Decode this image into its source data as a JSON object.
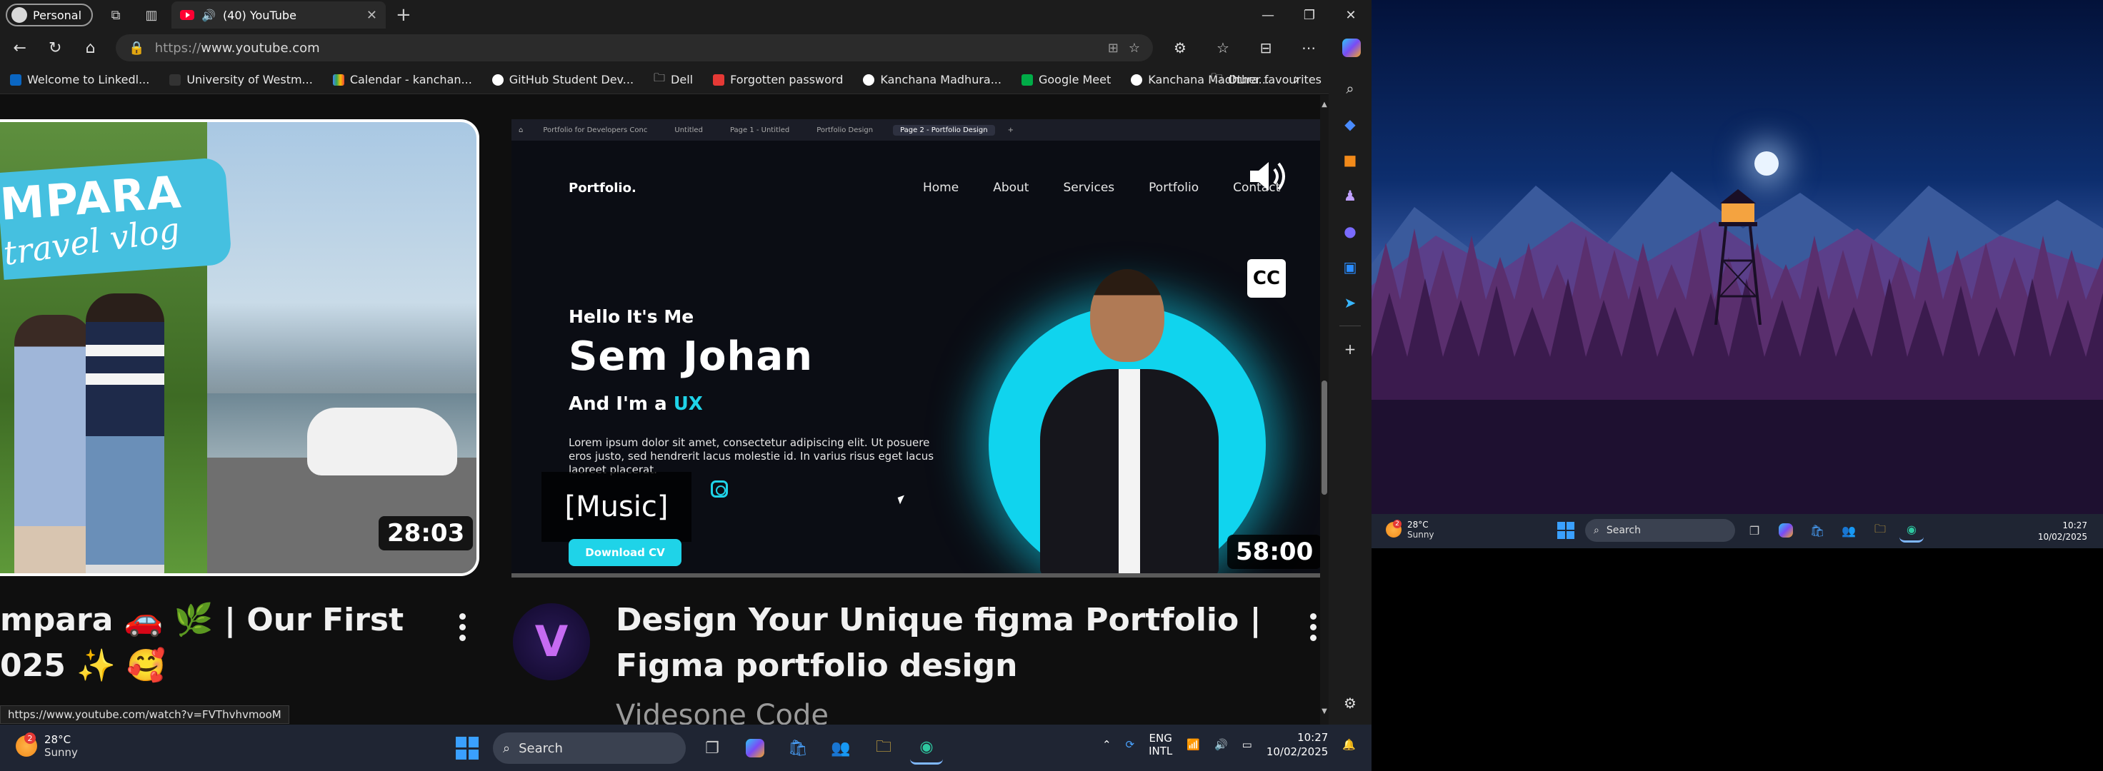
{
  "browser": {
    "profile_label": "Personal",
    "tab_title": "(40) YouTube",
    "url_scheme": "https://",
    "url_host": "www.youtube.com",
    "bookmarks": [
      {
        "label": "Welcome to Linkedl...",
        "color": "#0a66c2"
      },
      {
        "label": "University of Westm...",
        "color": "#333333"
      },
      {
        "label": "Calendar - kanchan...",
        "color": "#ea4335"
      },
      {
        "label": "GitHub Student Dev...",
        "color": "#ffffff"
      },
      {
        "label": "Dell",
        "color": "#cccccc"
      },
      {
        "label": "Forgotten password",
        "color": "#e53935"
      },
      {
        "label": "Kanchana Madhura...",
        "color": "#2196f3"
      },
      {
        "label": "Google Meet",
        "color": "#00ac47"
      },
      {
        "label": "Kanchana Madhura...",
        "color": "#2196f3"
      }
    ],
    "other_favourites": "Other favourites",
    "status_url": "https://www.youtube.com/watch?v=FVThvhvmooM"
  },
  "youtube": {
    "video1": {
      "title_line1": "mpara 🚗 🌿 | Our First",
      "title_line2": "025 ✨ 🥰",
      "duration": "28:03",
      "thumb_text": "MPARA",
      "thumb_sub": "travel vlog"
    },
    "video2": {
      "title": "Design Your Unique figma Portfolio | Figma portfolio design",
      "channel": "Videsone Code",
      "duration": "58:00",
      "caption": "[Music]",
      "cc_label": "CC",
      "inner_tabs": [
        "Portfolio for Developers Conc",
        "Untitled",
        "Page 1 - Untitled",
        "Portfolio Design",
        "Page 2 - Portfolio Design"
      ],
      "portfolio": {
        "logo": "Portfolio.",
        "nav": [
          "Home",
          "About",
          "Services",
          "Portfolio",
          "Contact"
        ],
        "hello": "Hello It's Me",
        "name": "Sem Johan",
        "role_prefix": "And I'm a",
        "role_accent": "UX",
        "lorem": "Lorem ipsum dolor sit amet, consectetur adipiscing elit. Ut posuere eros justo, sed hendrerit lacus molestie id. In varius risus eget lacus laoreet placerat.",
        "cta": "Download CV"
      }
    }
  },
  "taskbar": {
    "temp": "28°C",
    "condition": "Sunny",
    "weather_badge": "2",
    "search_label": "Search",
    "lang1": "ENG",
    "lang2": "INTL",
    "time": "10:27",
    "date": "10/02/2025"
  },
  "desktop_taskbar": {
    "temp": "28°C",
    "condition": "Sunny",
    "search_label": "Search",
    "time": "10:27",
    "date": "10/02/2025"
  },
  "colors": {
    "accent_cyan": "#1fd3e8",
    "youtube_red": "#ff0033",
    "taskbar": "#1f2533"
  }
}
